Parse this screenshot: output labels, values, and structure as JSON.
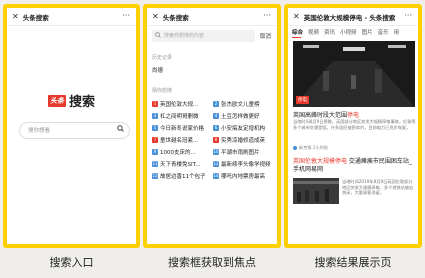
{
  "screens": [
    {
      "window_title": "头条搜索",
      "more_icon": "more-icon",
      "logo_mark": "头条",
      "logo_word": "搜索",
      "search_placeholder": "搜你想看"
    },
    {
      "window_title": "头条搜索",
      "search_placeholder": "搜索你想搜的内容",
      "cancel_label": "取消",
      "history_heading": "历史记录",
      "history_items": [
        "尚德"
      ],
      "hot_heading": "猜你想搜",
      "hot_items": [
        [
          "英国伦敦大规...",
          "张杰欧文儿童榜"
        ],
        [
          "杠之间明哥删微",
          "土豆怎样做更好"
        ],
        [
          "今日新冬说家价格",
          "小安搞友定增机构"
        ],
        [
          "童世越名冠紧...",
          "实秀凉婚修道成英"
        ],
        [
          "1000支床的...",
          "平湖市雨刷图片"
        ],
        [
          "天下青楼免SIT...",
          "最新续李头像学视频"
        ],
        [
          "故居边香11个包子",
          "哪吒内地票房最高"
        ]
      ],
      "hot_badge_colors": [
        "#e8392d",
        "#4a90d9"
      ]
    },
    {
      "window_title": "英国伦敦大规模停电 - 头条搜索",
      "tabs": [
        "综合",
        "视频",
        "资讯",
        "小视频",
        "图片",
        "音乐",
        "用"
      ],
      "hero_tag": "停电",
      "result1_title_pre": "英国高峰时段大范围",
      "result1_title_em": "停电",
      "result1_snippet": "当地时间8月9日傍晚，英国部分地区突发大规模停电事故，伦敦等多个城市交通受阻，许多居民被困车内，目前电力已逐步恢复。",
      "result1_meta": "新京报 2小时前",
      "result2_title_em": "英国伦敦大规模停电",
      "result2_title_post": " 交通瘫痪市民围困车站_手机网易网",
      "result2_snippet": "当地时间2019年8月9日英国伦敦部分地区突发大规模停电，多个地铁站被迫关闭，大量乘客滞留。"
    }
  ],
  "captions": [
    "搜索入口",
    "搜索框获取到焦点",
    "搜索结果展示页"
  ],
  "colors": {
    "frame": "#ffd000",
    "brand_red": "#e8392d"
  }
}
